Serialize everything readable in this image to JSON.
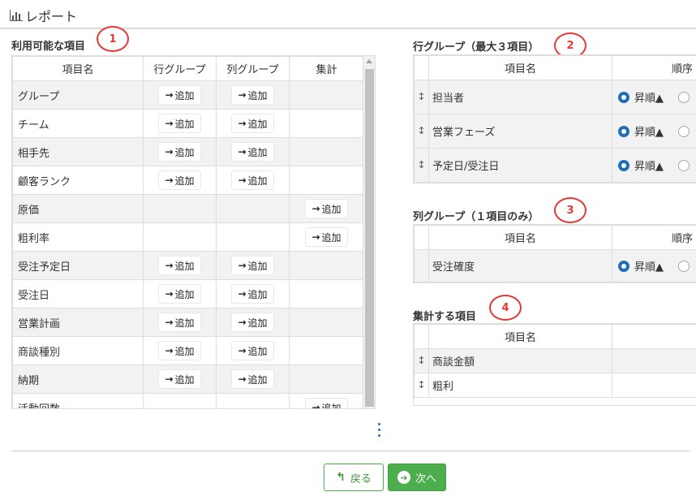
{
  "header": {
    "title": "レポート",
    "icon": "bar-chart-icon"
  },
  "available": {
    "title": "利用可能な項目",
    "badge": "1",
    "columns": [
      "項目名",
      "行グループ",
      "列グループ",
      "集計"
    ],
    "add_label": "追加",
    "rows": [
      {
        "name": "グループ",
        "row": true,
        "col": true,
        "agg": false
      },
      {
        "name": "チーム",
        "row": true,
        "col": true,
        "agg": false
      },
      {
        "name": "相手先",
        "row": true,
        "col": true,
        "agg": false
      },
      {
        "name": "顧客ランク",
        "row": true,
        "col": true,
        "agg": false
      },
      {
        "name": "原価",
        "row": false,
        "col": false,
        "agg": true
      },
      {
        "name": "粗利率",
        "row": false,
        "col": false,
        "agg": true
      },
      {
        "name": "受注予定日",
        "row": true,
        "col": true,
        "agg": false
      },
      {
        "name": "受注日",
        "row": true,
        "col": true,
        "agg": false
      },
      {
        "name": "営業計画",
        "row": true,
        "col": true,
        "agg": false
      },
      {
        "name": "商談種別",
        "row": true,
        "col": true,
        "agg": false
      },
      {
        "name": "納期",
        "row": true,
        "col": true,
        "agg": false
      },
      {
        "name": "活動回数",
        "row": false,
        "col": false,
        "agg": true
      }
    ]
  },
  "row_group": {
    "title": "行グループ（最大３項目）",
    "badge": "2",
    "columns": [
      "項目名",
      "順序"
    ],
    "rows": [
      {
        "name": "担当者",
        "order": "昇順▲"
      },
      {
        "name": "営業フェーズ",
        "order": "昇順▲"
      },
      {
        "name": "予定日/受注日",
        "order": "昇順▲"
      }
    ]
  },
  "col_group": {
    "title": "列グループ（１項目のみ）",
    "badge": "3",
    "columns": [
      "項目名",
      "順序"
    ],
    "rows": [
      {
        "name": "受注確度",
        "order": "昇順▲"
      }
    ]
  },
  "aggregate": {
    "title": "集計する項目",
    "badge": "4",
    "columns": [
      "項目名",
      ""
    ],
    "rows": [
      {
        "name": "商談金額"
      },
      {
        "name": "粗利"
      }
    ]
  },
  "footer": {
    "back_label": "戻る",
    "next_label": "次へ"
  },
  "colors": {
    "accent_green": "#4cae4c",
    "radio_blue": "#1e6fb8",
    "badge_red": "#e53935"
  }
}
